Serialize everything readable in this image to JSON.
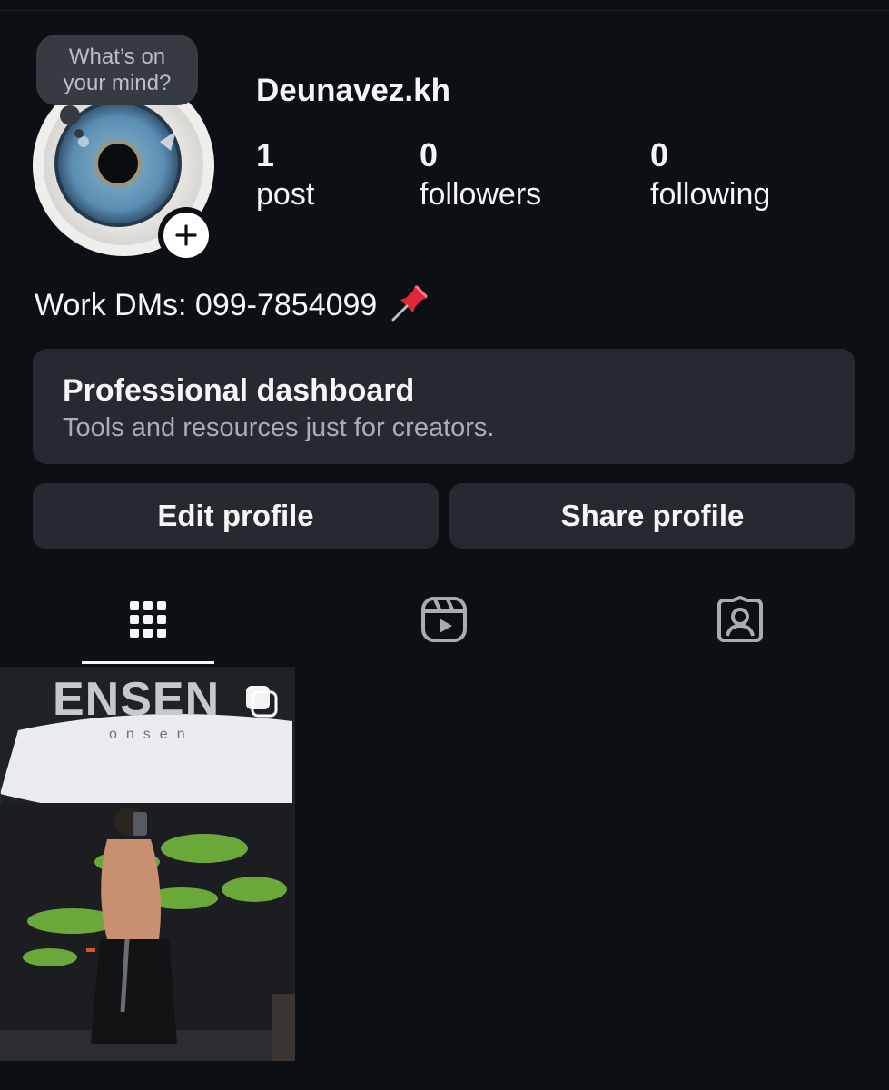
{
  "profile": {
    "note": {
      "line1": "What’s on",
      "line2": "your mind?"
    },
    "username": "Deunavez.kh",
    "stats": [
      {
        "value": "1",
        "label": "post"
      },
      {
        "value": "0",
        "label": "followers"
      },
      {
        "value": "0",
        "label": "following"
      }
    ],
    "bio": "Work DMs: 099-7854099",
    "bio_icon": "pushpin"
  },
  "dashboard": {
    "title": "Professional dashboard",
    "subtitle": "Tools and resources just for creators."
  },
  "actions": {
    "edit_label": "Edit profile",
    "share_label": "Share profile"
  },
  "tabs": [
    {
      "icon": "grid-icon",
      "active": true
    },
    {
      "icon": "reels-icon",
      "active": false
    },
    {
      "icon": "tagged-icon",
      "active": false
    }
  ],
  "posts": [
    {
      "brand": "ENSEN",
      "brand_sub": "onsen",
      "type": "carousel"
    }
  ],
  "colors": {
    "background": "#0c1014",
    "card": "#262a30",
    "text": "#f5f5f5",
    "muted": "#a8adb4"
  }
}
